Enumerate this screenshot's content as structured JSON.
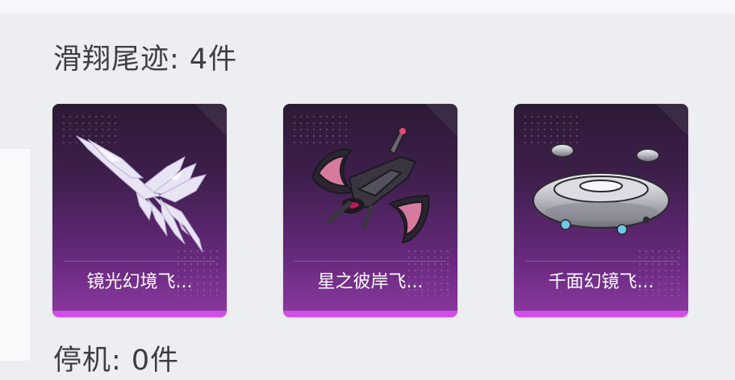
{
  "section": {
    "title": "滑翔尾迹: 4件",
    "next_title": "停机: 0件"
  },
  "items": [
    {
      "name": "镜光幻境飞...",
      "icon": "crystal-wing-trail-icon"
    },
    {
      "name": "星之彼岸飞...",
      "icon": "dark-wing-glider-icon"
    },
    {
      "name": "千面幻镜飞...",
      "icon": "silver-ufo-icon"
    }
  ],
  "colors": {
    "card_top": "#2b1a33",
    "card_bottom": "#8b3aa0",
    "accent_bar": "#d04fe6",
    "title_text": "#3c3e42"
  }
}
